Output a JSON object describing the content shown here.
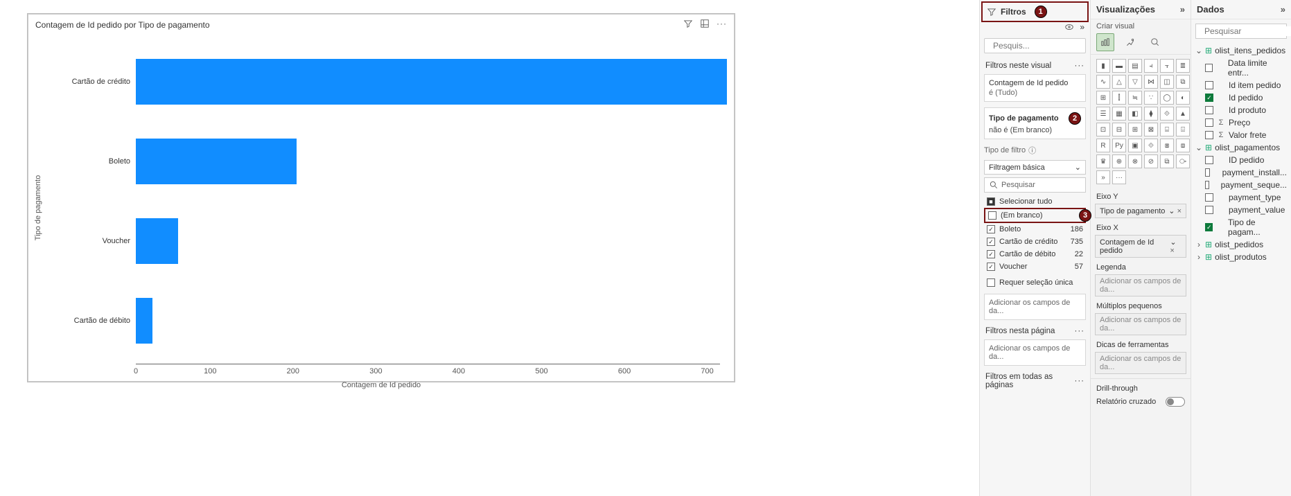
{
  "chart": {
    "title": "Contagem de Id pedido por Tipo de pagamento",
    "xlabel": "Contagem de Id pedido",
    "ylabel": "Tipo de pagamento"
  },
  "chart_data": {
    "type": "bar",
    "orientation": "horizontal",
    "title": "Contagem de Id pedido por Tipo de pagamento",
    "xlabel": "Contagem de Id pedido",
    "ylabel": "Tipo de pagamento",
    "xlim": [
      0,
      700
    ],
    "xticks": [
      0,
      100,
      200,
      300,
      400,
      500,
      600,
      700
    ],
    "categories": [
      "Cartão de crédito",
      "Boleto",
      "Voucher",
      "Cartão de débito"
    ],
    "values": [
      700,
      190,
      50,
      20
    ]
  },
  "filters_panel": {
    "title": "Filtros",
    "search_placeholder": "Pesquis...",
    "section_visual": "Filtros neste visual",
    "card1_title": "Contagem de Id pedido",
    "card1_sub": "é (Tudo)",
    "card2_title": "Tipo de pagamento",
    "card2_sub": "não é (Em branco)",
    "filter_type_label": "Tipo de filtro",
    "filter_type_value": "Filtragem básica",
    "filter_search_placeholder": "Pesquisar",
    "select_all": "Selecionar tudo",
    "options": [
      {
        "label": "(Em branco)",
        "count": "",
        "checked": false
      },
      {
        "label": "Boleto",
        "count": "186",
        "checked": true
      },
      {
        "label": "Cartão de crédito",
        "count": "735",
        "checked": true
      },
      {
        "label": "Cartão de débito",
        "count": "22",
        "checked": true
      },
      {
        "label": "Voucher",
        "count": "57",
        "checked": true
      }
    ],
    "require_single": "Requer seleção única",
    "add_fields": "Adicionar os campos de da...",
    "section_page": "Filtros nesta página",
    "section_all": "Filtros em todas as páginas"
  },
  "viz_panel": {
    "title": "Visualizações",
    "subtitle": "Criar visual",
    "wells": {
      "y_label": "Eixo Y",
      "y_value": "Tipo de pagamento",
      "x_label": "Eixo X",
      "x_value": "Contagem de Id pedido",
      "legend_label": "Legenda",
      "legend_value": "Adicionar os campos de da...",
      "small_label": "Múltiplos pequenos",
      "small_value": "Adicionar os campos de da...",
      "tooltip_label": "Dicas de ferramentas",
      "tooltip_value": "Adicionar os campos de da..."
    },
    "drill_title": "Drill-through",
    "drill_cross": "Relatório cruzado"
  },
  "data_panel": {
    "title": "Dados",
    "search_placeholder": "Pesquisar",
    "tables": [
      {
        "name": "olist_itens_pedidos",
        "expanded": true,
        "fields": [
          {
            "name": "Data limite entr...",
            "checked": false,
            "sigma": false
          },
          {
            "name": "Id item pedido",
            "checked": false,
            "sigma": false
          },
          {
            "name": "Id pedido",
            "checked": true,
            "sigma": false
          },
          {
            "name": "Id produto",
            "checked": false,
            "sigma": false
          },
          {
            "name": "Preço",
            "checked": false,
            "sigma": true
          },
          {
            "name": "Valor frete",
            "checked": false,
            "sigma": true
          }
        ]
      },
      {
        "name": "olist_pagamentos",
        "expanded": true,
        "fields": [
          {
            "name": "ID pedido",
            "checked": false,
            "sigma": false
          },
          {
            "name": "payment_install...",
            "checked": false,
            "sigma": false
          },
          {
            "name": "payment_seque...",
            "checked": false,
            "sigma": false
          },
          {
            "name": "payment_type",
            "checked": false,
            "sigma": false
          },
          {
            "name": "payment_value",
            "checked": false,
            "sigma": false
          },
          {
            "name": "Tipo de pagam...",
            "checked": true,
            "sigma": false
          }
        ]
      },
      {
        "name": "olist_pedidos",
        "expanded": false,
        "fields": []
      },
      {
        "name": "olist_produtos",
        "expanded": false,
        "fields": []
      }
    ]
  },
  "badges": {
    "b1": "1",
    "b2": "2",
    "b3": "3"
  }
}
